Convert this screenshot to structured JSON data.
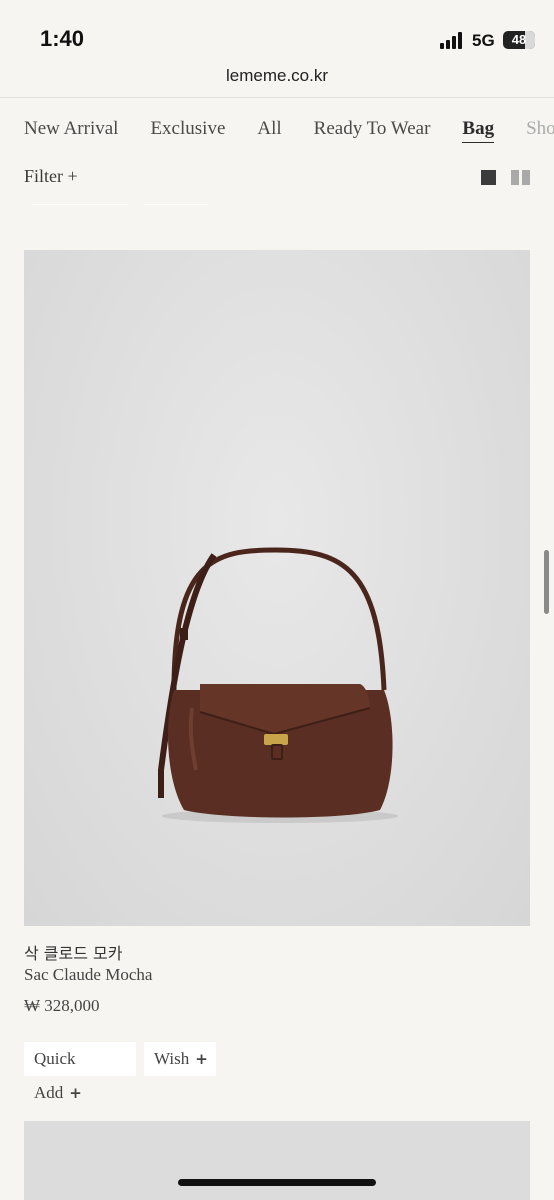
{
  "status": {
    "time": "1:40",
    "network": "5G",
    "battery": "48"
  },
  "browser": {
    "url": "lememe.co.kr"
  },
  "nav": {
    "items": [
      "New Arrival",
      "Exclusive",
      "All",
      "Ready To Wear",
      "Bag",
      "Shoes"
    ],
    "active": "Bag"
  },
  "filter": {
    "label": "Filter +"
  },
  "product": {
    "name_kr": "삭 클로드 모카",
    "name_en": "Sac Claude Mocha",
    "price": "₩ 328,000",
    "quick_add": "Quick Add",
    "wish": "Wish",
    "plus": "+",
    "colors": {
      "bag": "#5a2e22",
      "hardware": "#c9a44a",
      "background": "#dedede"
    }
  },
  "icons": [
    "signal-icon",
    "battery-icon",
    "grid-single-icon",
    "grid-double-icon"
  ]
}
